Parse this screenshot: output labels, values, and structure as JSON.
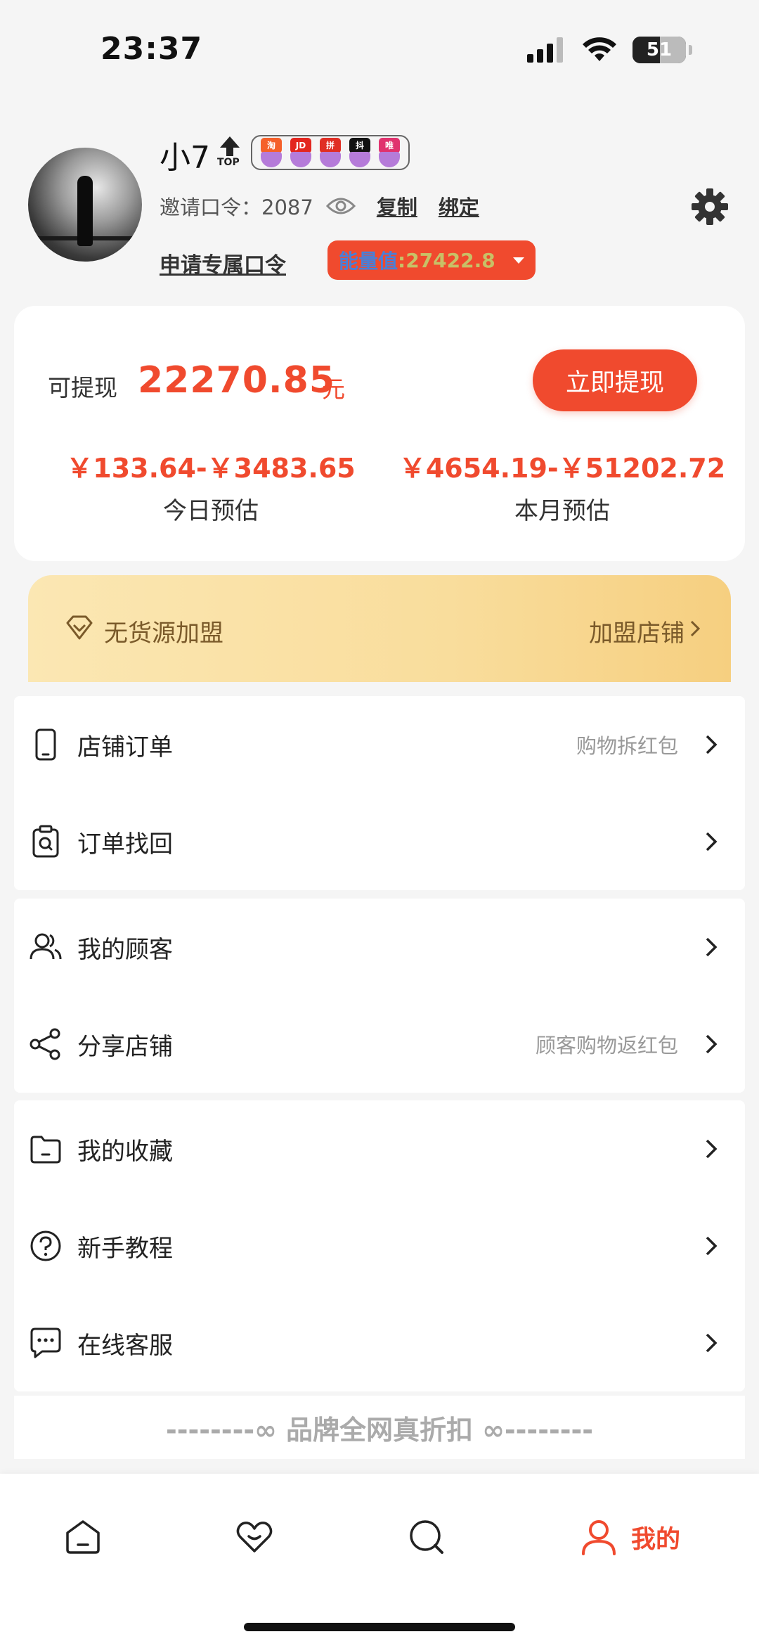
{
  "status_bar": {
    "time": "23:37",
    "battery": "51"
  },
  "profile": {
    "username": "小7",
    "top_badge": "TOP",
    "platforms": [
      "淘",
      "JD",
      "拼",
      "抖",
      "唯"
    ],
    "invite_label": "邀请口令：2087",
    "copy_label": "复制",
    "bind_label": "绑定",
    "apply_label": "申请专属口令",
    "energy_label": "能量值",
    "energy_value": ":27422.8"
  },
  "earnings": {
    "withdrawable_label": "可提现",
    "amount": "22270.85",
    "unit": "元",
    "withdraw_button": "立即提现",
    "today_range": "￥133.64-￥3483.65",
    "today_label": "今日预估",
    "month_range": "￥4654.19-￥51202.72",
    "month_label": "本月预估"
  },
  "franchise": {
    "title": "无货源加盟",
    "link": "加盟店铺"
  },
  "menu_groups": [
    {
      "items": [
        {
          "label": "店铺订单",
          "hint": "购物拆红包",
          "icon": "phone-icon"
        },
        {
          "label": "订单找回",
          "hint": "",
          "icon": "order-search-icon"
        }
      ]
    },
    {
      "items": [
        {
          "label": "我的顾客",
          "hint": "",
          "icon": "customers-icon"
        },
        {
          "label": "分享店铺",
          "hint": "顾客购物返红包",
          "icon": "share-icon"
        }
      ]
    },
    {
      "items": [
        {
          "label": "我的收藏",
          "hint": "",
          "icon": "folder-icon"
        },
        {
          "label": "新手教程",
          "hint": "",
          "icon": "help-icon"
        },
        {
          "label": "在线客服",
          "hint": "",
          "icon": "chat-icon"
        }
      ]
    }
  ],
  "slogan": "--------∞  品牌全网真折扣  ∞--------",
  "tabbar": {
    "active_label": "我的"
  },
  "colors": {
    "accent": "#f04a2e",
    "gold_text": "#7a5a2a",
    "banner_from": "#fbe7b3",
    "banner_to": "#f6cf80"
  }
}
